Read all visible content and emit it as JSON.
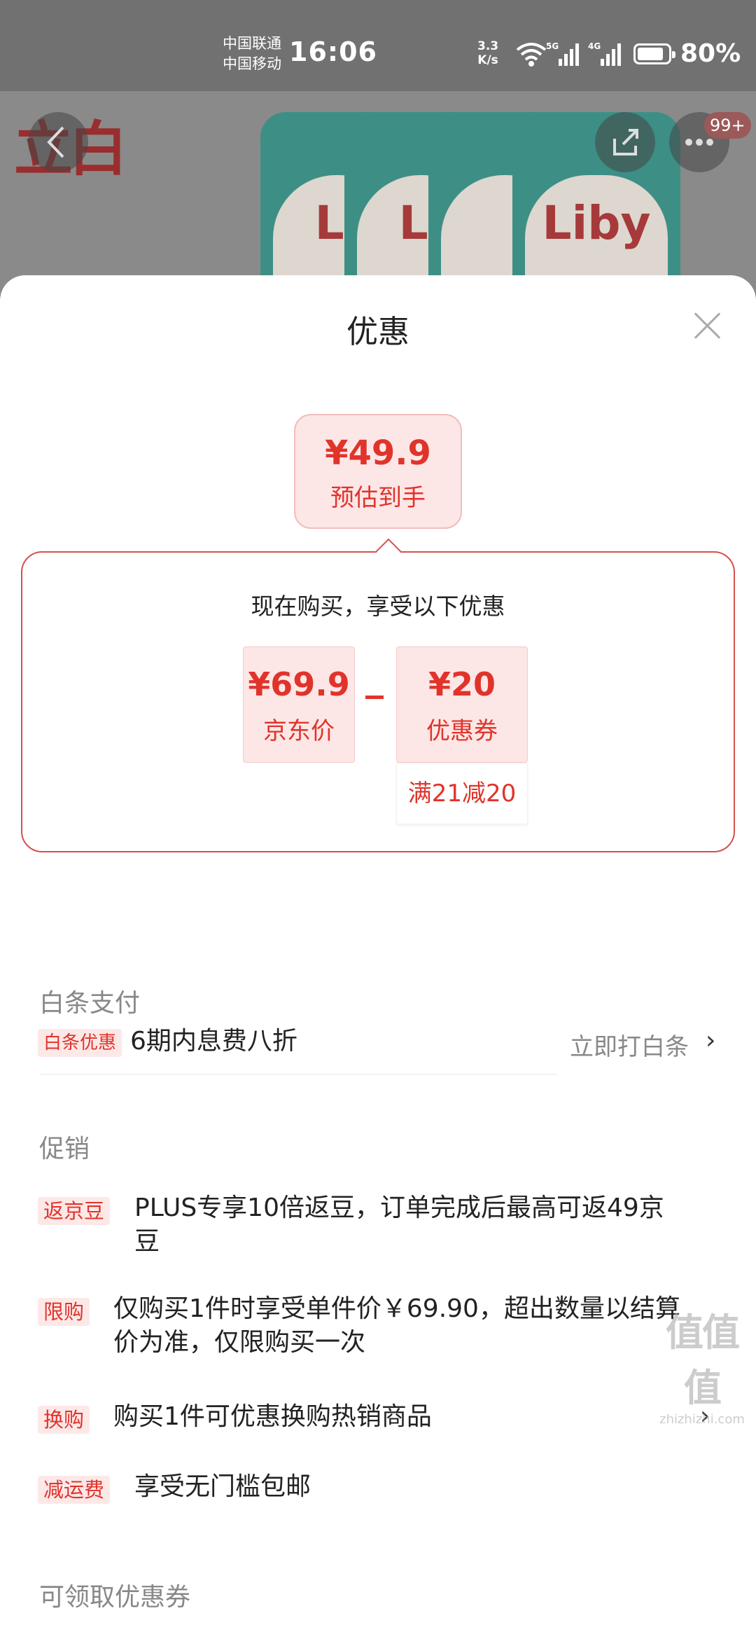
{
  "status_bar": {
    "carrier_1": "中国联通",
    "carrier_2": "中国移动",
    "time": "16:06",
    "net_speed_value": "3.3",
    "net_speed_unit": "K/s",
    "signal_1_label": "5G",
    "signal_2_label": "4G",
    "battery": "80%"
  },
  "product_header": {
    "brand_mark": "立白",
    "pouch_brand": "Liby",
    "pouch_brand_partial": "Li",
    "more_badge": "99+"
  },
  "sheet": {
    "title": "优惠",
    "estimate": {
      "price": "¥49.9",
      "label": "预估到手"
    },
    "calc": {
      "title": "现在购买，享受以下优惠",
      "jd_price": {
        "price": "¥69.9",
        "label": "京东价"
      },
      "coupon": {
        "price": "¥20",
        "label": "优惠券",
        "rule": "满21减20"
      }
    },
    "baitiao": {
      "title": "白条支付",
      "tag": "白条优惠",
      "text": "6期内息费八折",
      "action": "立即打白条",
      "chevron": "›"
    },
    "promotions": {
      "title": "促销",
      "items": [
        {
          "tag": "返京豆",
          "line1": "PLUS专享10倍返豆，订单完成后最高可返49京",
          "line2": "豆"
        },
        {
          "tag": "限购",
          "line1": "仅购买1件时享受单件价￥69.90，超出数量以结算",
          "line2": "价为准，仅限购买一次"
        },
        {
          "tag": "换购",
          "line1": "购买1件可优惠换购热销商品",
          "chevron": "›"
        },
        {
          "tag": "减运费",
          "line1": "享受无门槛包邮"
        }
      ]
    },
    "coupons_section": {
      "title": "可领取优惠券"
    }
  },
  "watermark": {
    "main": "值值值",
    "sub": "zhizhizhi.com"
  },
  "colors": {
    "accent": "#e0342b",
    "tag_bg": "#fde8e8",
    "card_bg": "#fde6e6",
    "border": "#d6504b"
  }
}
